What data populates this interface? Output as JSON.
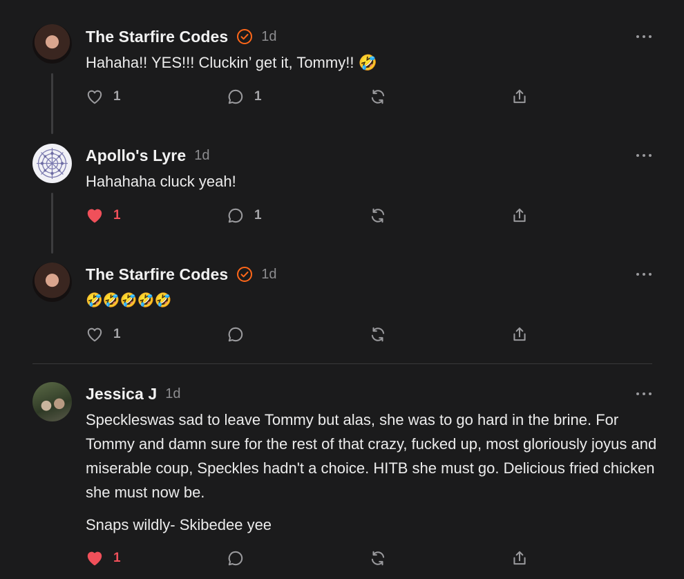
{
  "comments": [
    {
      "author": "The Starfire Codes",
      "time": "1d",
      "text": "Hahaha!! YES!!! Cluckin’ get it, Tommy!! 🤣",
      "likes": "1",
      "replies": "1",
      "liked": false
    },
    {
      "author": "Apollo's Lyre",
      "time": "1d",
      "text": "Hahahaha cluck yeah!",
      "likes": "1",
      "replies": "1",
      "liked": true
    },
    {
      "author": "The Starfire Codes",
      "time": "1d",
      "text": "🤣🤣🤣🤣🤣",
      "likes": "1",
      "replies": "",
      "liked": false
    },
    {
      "author": "Jessica J",
      "time": "1d",
      "paragraphs": [
        "Speckleswas sad to leave Tommy but alas, she was to go hard in the brine. For Tommy and damn sure for the rest of that crazy, fucked up, most gloriously joyus and miserable coup, Speckles hadn't a choice. HITB she must go. Delicious fried chicken she must now be.",
        "Snaps wildly- Skibedee yee"
      ],
      "likes": "1",
      "replies": "",
      "liked": true
    }
  ],
  "colors": {
    "background": "#1b1b1c",
    "verified": "#ff6719",
    "liked": "#f0505a",
    "icon": "#9a9a9d"
  }
}
